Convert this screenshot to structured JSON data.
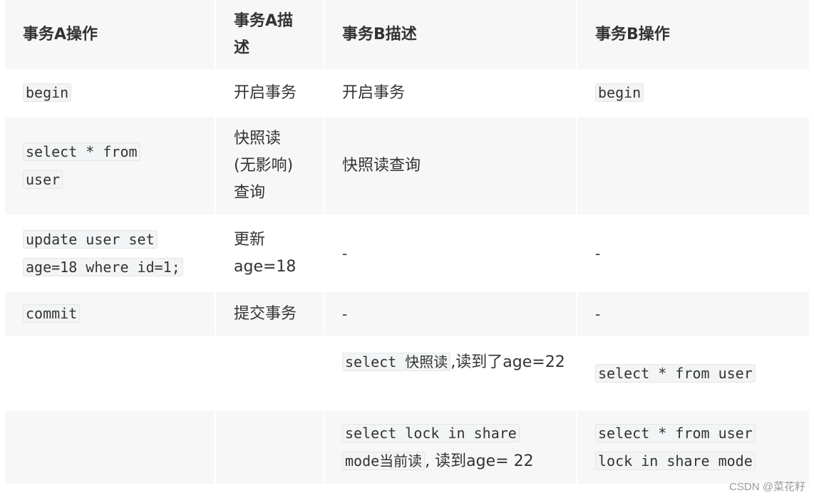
{
  "table": {
    "headers": [
      "事务A操作",
      "事务A描述",
      "事务B描述",
      "事务B操作"
    ],
    "rows": [
      {
        "a_op": [
          "begin"
        ],
        "a_desc": "开启事务",
        "b_desc": "开启事务",
        "b_op": [
          "begin"
        ]
      },
      {
        "a_op": [
          "select * from",
          "user"
        ],
        "a_desc": "快照读 (无影响) 查询",
        "b_desc": "快照读查询",
        "b_op": []
      },
      {
        "a_op": [
          "update user set",
          "age=18 where id=1;"
        ],
        "a_desc": "更新 age=18",
        "b_desc": "-",
        "b_op": [
          "-"
        ]
      },
      {
        "a_op": [
          "commit"
        ],
        "a_desc": "提交事务",
        "b_desc": "-",
        "b_op": [
          "-"
        ]
      },
      {
        "a_op": [],
        "a_desc": "",
        "b_desc": {
          "code": "select 快照读",
          "text": ",读到了age=22"
        },
        "b_op": [
          "select * from user"
        ]
      },
      {
        "a_op": [],
        "a_desc": "",
        "b_desc": {
          "code1": "select lock in share",
          "code2": "mode当前读",
          "text": ", 读到age= 22"
        },
        "b_op": [
          "select * from user",
          "lock in share mode"
        ]
      }
    ]
  },
  "a_desc_lines": {
    "row2": [
      "快照读",
      "(无影响)",
      "查询"
    ],
    "row3": [
      "更新",
      "age=18"
    ]
  },
  "watermark": "CSDN @菜花籽"
}
